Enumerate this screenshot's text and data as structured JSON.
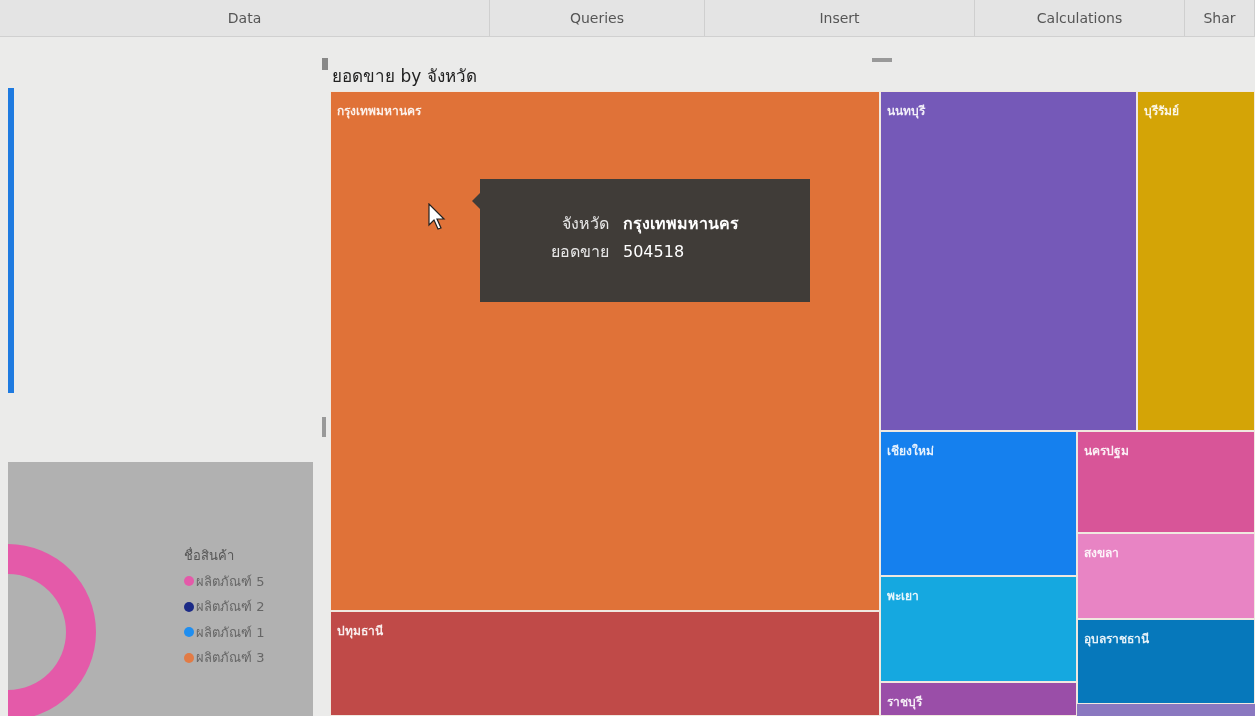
{
  "ribbon_tabs": [
    {
      "label": "Data"
    },
    {
      "label": "Queries"
    },
    {
      "label": "Insert"
    },
    {
      "label": "Calculations"
    },
    {
      "label": "Shar"
    }
  ],
  "donut_legend": {
    "title": "ชื่อสินค้า",
    "items": [
      {
        "label": "ผลิตภัณฑ์ 5",
        "color": "#e45aa9"
      },
      {
        "label": "ผลิตภัณฑ์ 2",
        "color": "#1b2a86"
      },
      {
        "label": "ผลิตภัณฑ์ 1",
        "color": "#1f8ef0"
      },
      {
        "label": "ผลิตภัณฑ์ 3",
        "color": "#e27b45"
      }
    ]
  },
  "treemap": {
    "title": "ยอดขาย by จังหวัด",
    "tiles": [
      {
        "label": "กรุงเทพมหานคร",
        "color": "#e07238"
      },
      {
        "label": "ปทุมธานี",
        "color": "#c04a48"
      },
      {
        "label": "นนทบุรี",
        "color": "#7559b8"
      },
      {
        "label": "บุรีรัมย์",
        "color": "#d4a406"
      },
      {
        "label": "เชียงใหม่",
        "color": "#1580ee"
      },
      {
        "label": "พะเยา",
        "color": "#15a8e0"
      },
      {
        "label": "ราชบุรี",
        "color": "#9a4ea8"
      },
      {
        "label": "นครปฐม",
        "color": "#d85598"
      },
      {
        "label": "สงขลา",
        "color": "#e884c4"
      },
      {
        "label": "อุบลราชธานี",
        "color": "#0678bb"
      }
    ],
    "tooltip": [
      {
        "name": "จังหวัด",
        "value": "กรุงเทพมหานคร"
      },
      {
        "name": "ยอดขาย",
        "value": "504518"
      }
    ]
  }
}
